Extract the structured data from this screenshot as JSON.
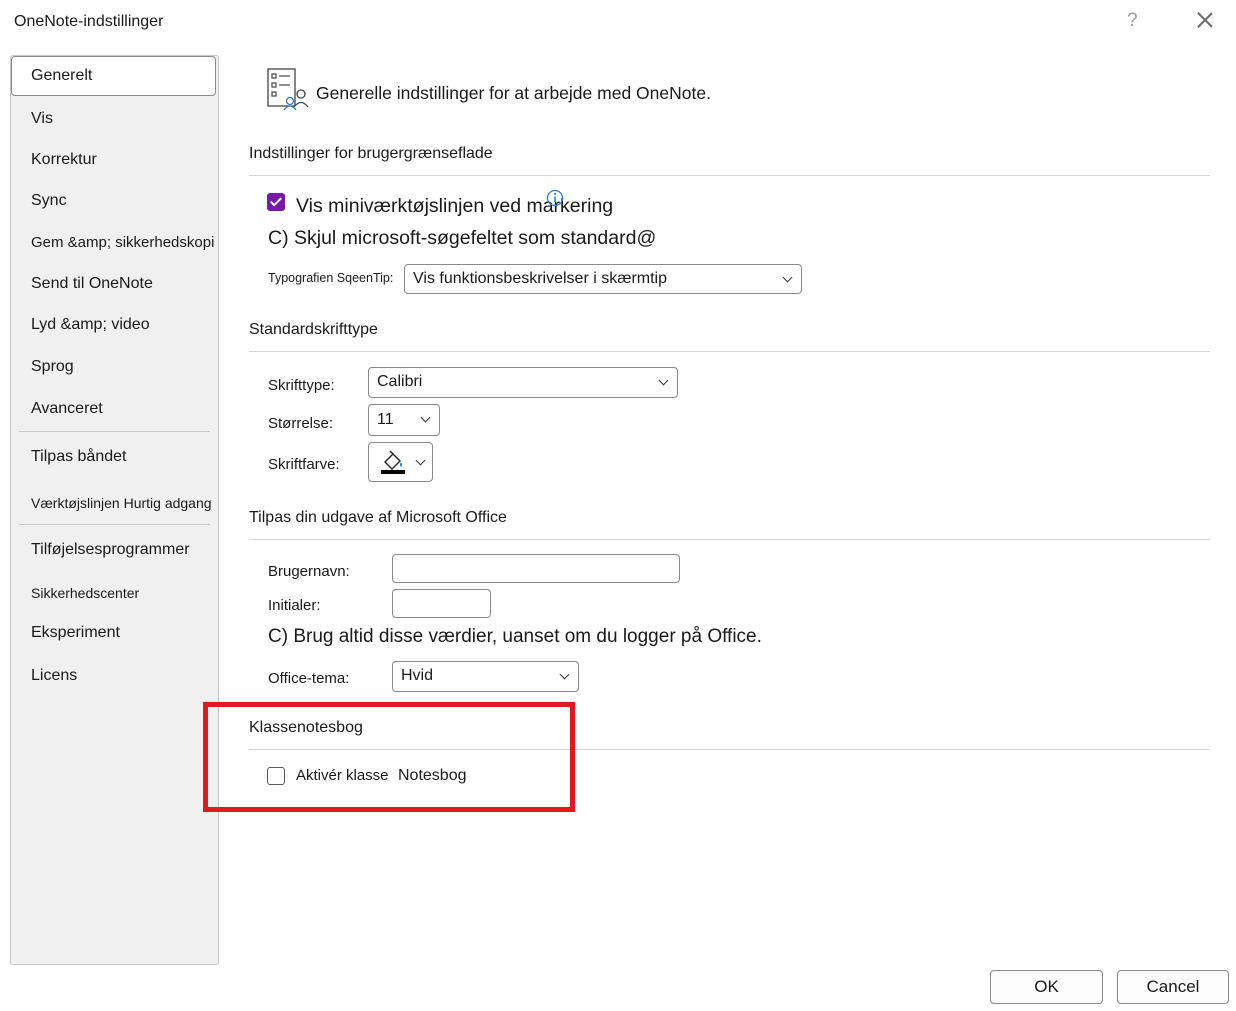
{
  "window": {
    "title": "OneNote-indstillinger",
    "help_glyph": "?"
  },
  "sidebar": {
    "items": [
      {
        "label": "Generelt"
      },
      {
        "label": "Vis"
      },
      {
        "label": "Korrektur"
      },
      {
        "label": "Sync"
      },
      {
        "label": "Gem &amp; sikkerhedskopi"
      },
      {
        "label": "Send til OneNote"
      },
      {
        "label": "Lyd &amp; video"
      },
      {
        "label": "Sprog"
      },
      {
        "label": "Avanceret"
      },
      {
        "label": "Tilpas båndet"
      },
      {
        "label": "Værktøjslinjen Hurtig adgang"
      },
      {
        "label": "Tilføjelsesprogrammer"
      },
      {
        "label": "Sikkerhedscenter"
      },
      {
        "label": "Eksperiment"
      },
      {
        "label": "Licens"
      }
    ]
  },
  "main": {
    "header": "Generelle indstillinger for at arbejde med OneNote.",
    "ui_section": {
      "title": "Indstillinger for brugergrænseflade",
      "mini_toolbar_label": "Vis miniværktøjslinjen ved markering",
      "mini_toolbar_checked": true,
      "hide_search_label": "C) Skjul microsoft-søgefeltet som standard@",
      "screentip_label": "Typografien SqeenTip:",
      "screentip_value": "Vis funktionsbeskrivelser i skærmtip"
    },
    "font_section": {
      "title": "Standardskrifttype",
      "font_label": "Skrifttype:",
      "font_value": "Calibri",
      "size_label": "Størrelse:",
      "size_value": "11",
      "color_label": "Skriftfarve:"
    },
    "office_section": {
      "title": "Tilpas din udgave af Microsoft Office",
      "username_label": "Brugernavn:",
      "username_value": "",
      "initials_label": "Initialer:",
      "initials_value": "",
      "always_use_label": "C) Brug altid disse værdier, uanset om du logger på Office.",
      "theme_label": "Office-tema:",
      "theme_value": "Hvid"
    },
    "class_section": {
      "title": "Klassenotesbog",
      "enable_label": "Aktivér klasse",
      "enable_label_2": "Notesbog",
      "enable_checked": false
    }
  },
  "footer": {
    "ok_label": "OK",
    "cancel_label": "Cancel"
  },
  "colors": {
    "accent": "#7719aa",
    "highlight": "#e2191f"
  }
}
